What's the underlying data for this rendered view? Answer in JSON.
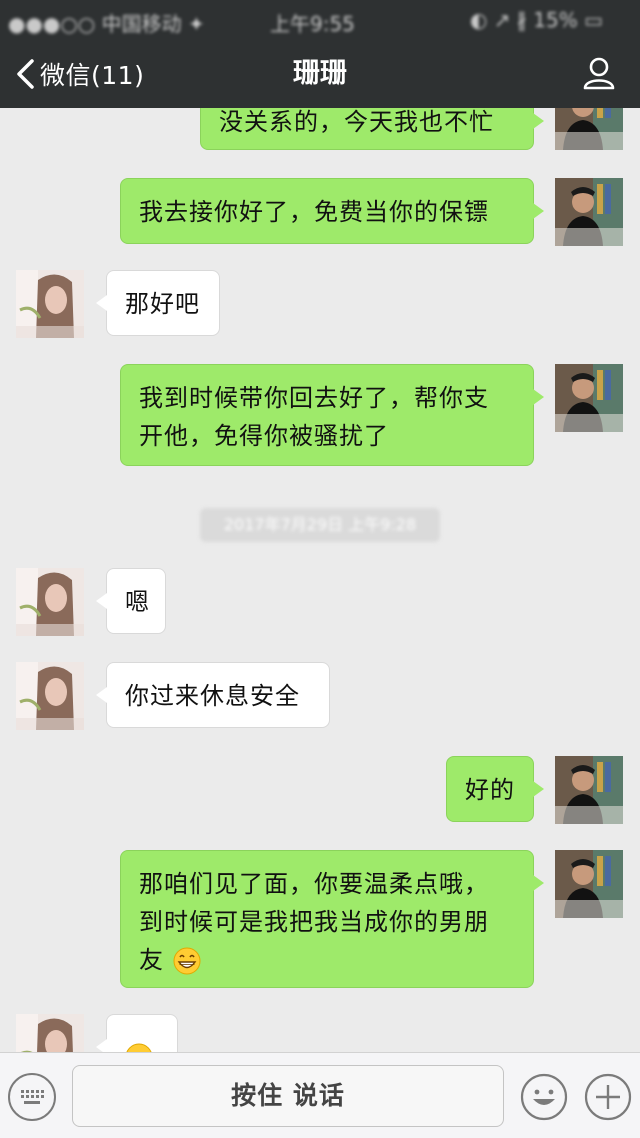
{
  "status_bar": {
    "carrier": "●●●○○ 中国移动 ✦",
    "time": "上午9:55",
    "right": "◐ ↗ ∦ 15% ▭"
  },
  "nav": {
    "back_label": "微信(11)",
    "title": "珊珊"
  },
  "messages": [
    {
      "from": "me",
      "text": "没关系的，今天我也不忙"
    },
    {
      "from": "me",
      "text": "我去接你好了，免费当你的保镖"
    },
    {
      "from": "her",
      "text": "那好吧"
    },
    {
      "from": "me",
      "lines": [
        "我到时候带你回去好了，帮你支",
        "开他，免得你被骚扰了"
      ]
    },
    {
      "from": "her",
      "text": "嗯"
    },
    {
      "from": "her",
      "text": "你过来休息安全"
    },
    {
      "from": "me",
      "text": "好的"
    },
    {
      "from": "me",
      "lines": [
        "那咱们见了面，你要温柔点哦，",
        "到时候可是我把我当成你的男朋",
        "友"
      ],
      "emoji": "grinning-face"
    },
    {
      "from": "her",
      "emoji": "face-emoji"
    }
  ],
  "timestamp": "2017年7月29日 上午9:28",
  "input_bar": {
    "voice_label": "按住 说话"
  },
  "colors": {
    "header_bg": "#2e3132",
    "chat_bg": "#ebebeb",
    "my_bubble": "#9eea6a",
    "her_bubble": "#ffffff"
  }
}
